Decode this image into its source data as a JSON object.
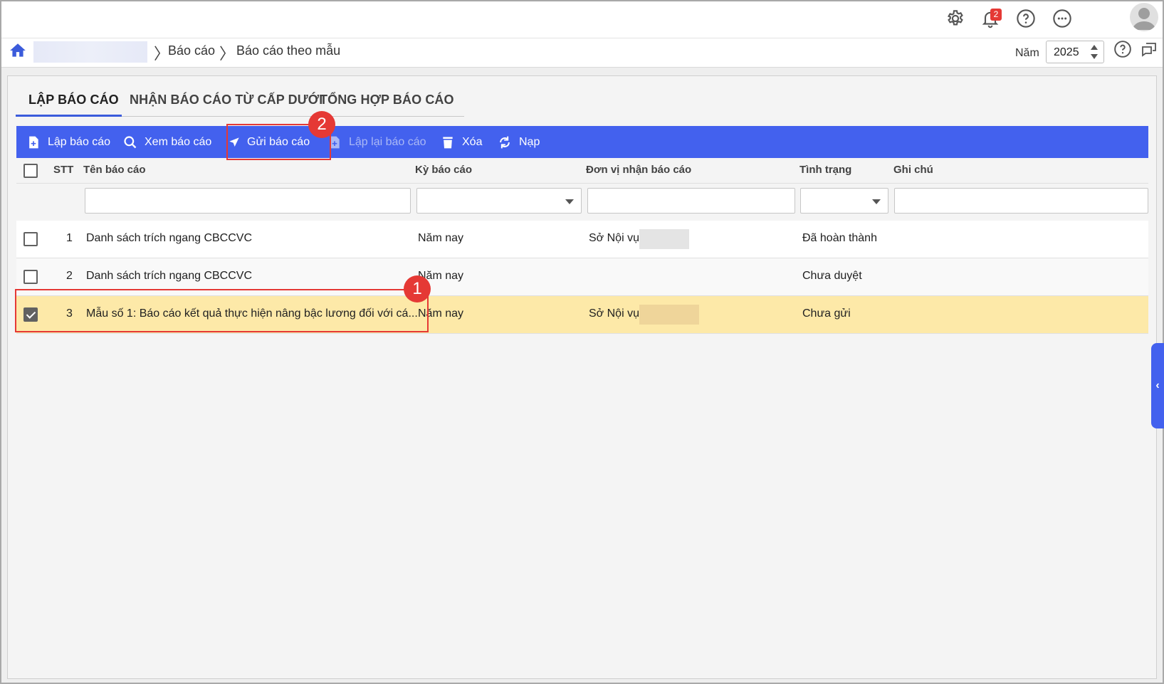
{
  "topbar": {
    "icons": [
      "gear-icon",
      "bell-icon",
      "help-icon",
      "more-icon",
      "avatar"
    ],
    "notification_count": "2"
  },
  "breadcrumb": {
    "items": [
      "Báo cáo",
      "Báo cáo theo mẫu"
    ],
    "year_label": "Năm",
    "year_value": "2025"
  },
  "tabs": [
    {
      "label": "LẬP BÁO CÁO",
      "active": true
    },
    {
      "label": "NHẬN BÁO CÁO TỪ CẤP DƯỚI",
      "active": false
    },
    {
      "label": "TỔNG HỢP BÁO CÁO",
      "active": false
    }
  ],
  "toolbar": {
    "create": "Lập báo cáo",
    "view": "Xem báo cáo",
    "send": "Gửi báo cáo",
    "recreate": "Lập lại báo cáo",
    "delete": "Xóa",
    "reload": "Nạp"
  },
  "annotations": {
    "step1": "1",
    "step2": "2"
  },
  "table": {
    "headers": {
      "stt": "STT",
      "name": "Tên báo cáo",
      "period": "Kỳ báo cáo",
      "receiver": "Đơn vị nhận báo cáo",
      "status": "Tình trạng",
      "note": "Ghi chú"
    },
    "rows": [
      {
        "stt": "1",
        "name": "Danh sách trích ngang CBCCVC",
        "period": "Năm nay",
        "receiver": "Sở Nội vụ",
        "status": "Đã hoàn thành",
        "checked": false
      },
      {
        "stt": "2",
        "name": "Danh sách trích ngang CBCCVC",
        "period": "Năm nay",
        "receiver": "",
        "status": "Chưa duyệt",
        "checked": false
      },
      {
        "stt": "3",
        "name": "Mẫu số 1: Báo cáo kết quả thực hiện nâng bậc lương đối với cá...",
        "period": "Năm nay",
        "receiver": "Sở Nội vụ",
        "status": "Chưa gửi",
        "checked": true
      }
    ]
  },
  "colors": {
    "accent": "#4361ee",
    "selected_row": "#fde9a8",
    "highlight": "#e53935"
  }
}
